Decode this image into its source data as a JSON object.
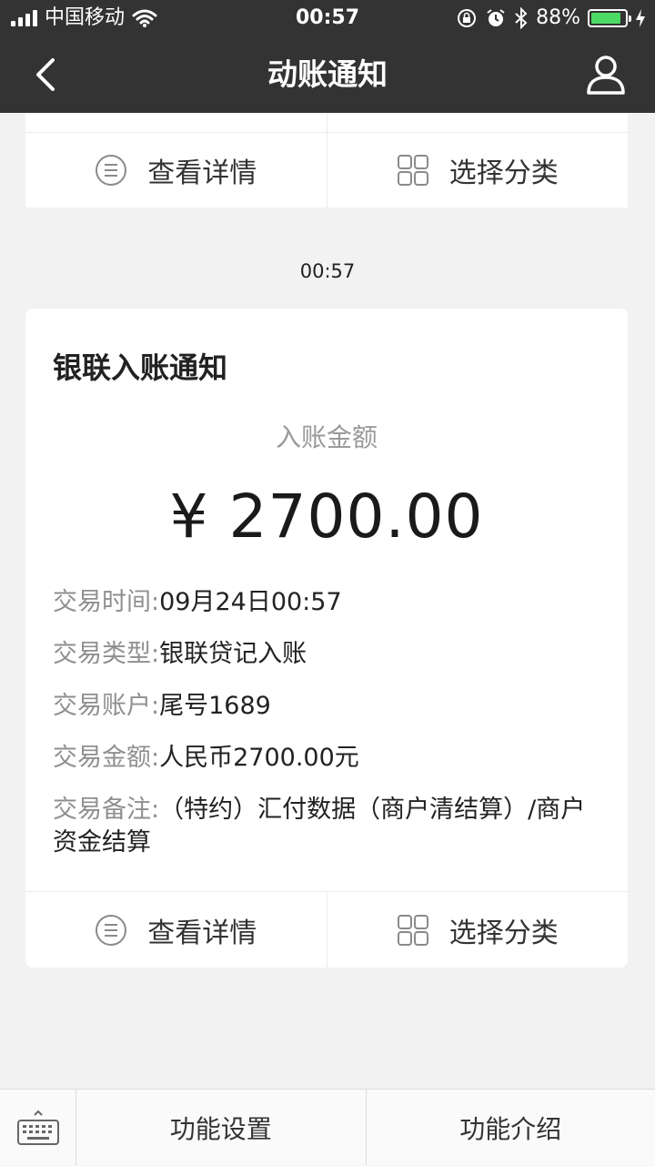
{
  "status_bar": {
    "carrier": "中国移动",
    "time": "00:57",
    "battery": "88%",
    "battery_level": 0.88
  },
  "nav": {
    "title": "动账通知"
  },
  "prev_card": {
    "action_details": "查看详情",
    "action_category": "选择分类"
  },
  "message": {
    "timestamp": "00:57",
    "card": {
      "title": "银联入账通知",
      "amount_label": "入账金额",
      "amount_value": "¥ 2700.00",
      "details": [
        {
          "key": "交易时间:",
          "value": "09月24日00:57"
        },
        {
          "key": "交易类型:",
          "value": "银联贷记入账"
        },
        {
          "key": "交易账户:",
          "value": "尾号1689"
        },
        {
          "key": "交易金额:",
          "value": "人民币2700.00元"
        },
        {
          "key": "交易备注:",
          "value": "（特约）汇付数据（商户清结算）/商户资金结算"
        }
      ],
      "action_details": "查看详情",
      "action_category": "选择分类"
    }
  },
  "tab_bar": {
    "item1": "功能设置",
    "item2": "功能介绍"
  }
}
